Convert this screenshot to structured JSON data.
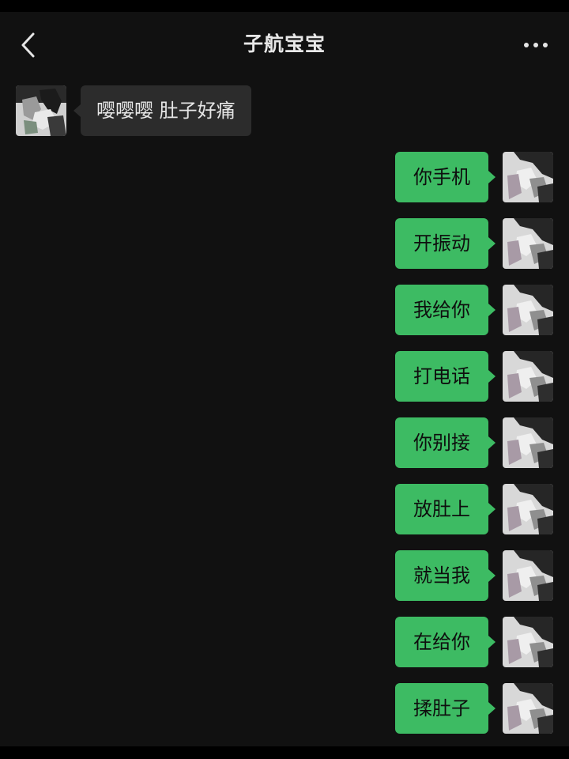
{
  "header": {
    "title": "子航宝宝",
    "back_icon": "chevron-left-icon",
    "more_icon": "more-icon"
  },
  "colors": {
    "background": "#111111",
    "incoming_bubble": "#2c2c2c",
    "outgoing_bubble": "#3dbb63"
  },
  "messages": [
    {
      "direction": "incoming",
      "text": "嘤嘤嘤 肚子好痛"
    },
    {
      "direction": "outgoing",
      "text": "你手机"
    },
    {
      "direction": "outgoing",
      "text": "开振动"
    },
    {
      "direction": "outgoing",
      "text": "我给你"
    },
    {
      "direction": "outgoing",
      "text": "打电话"
    },
    {
      "direction": "outgoing",
      "text": "你别接"
    },
    {
      "direction": "outgoing",
      "text": "放肚上"
    },
    {
      "direction": "outgoing",
      "text": "就当我"
    },
    {
      "direction": "outgoing",
      "text": "在给你"
    },
    {
      "direction": "outgoing",
      "text": "揉肚子"
    }
  ]
}
